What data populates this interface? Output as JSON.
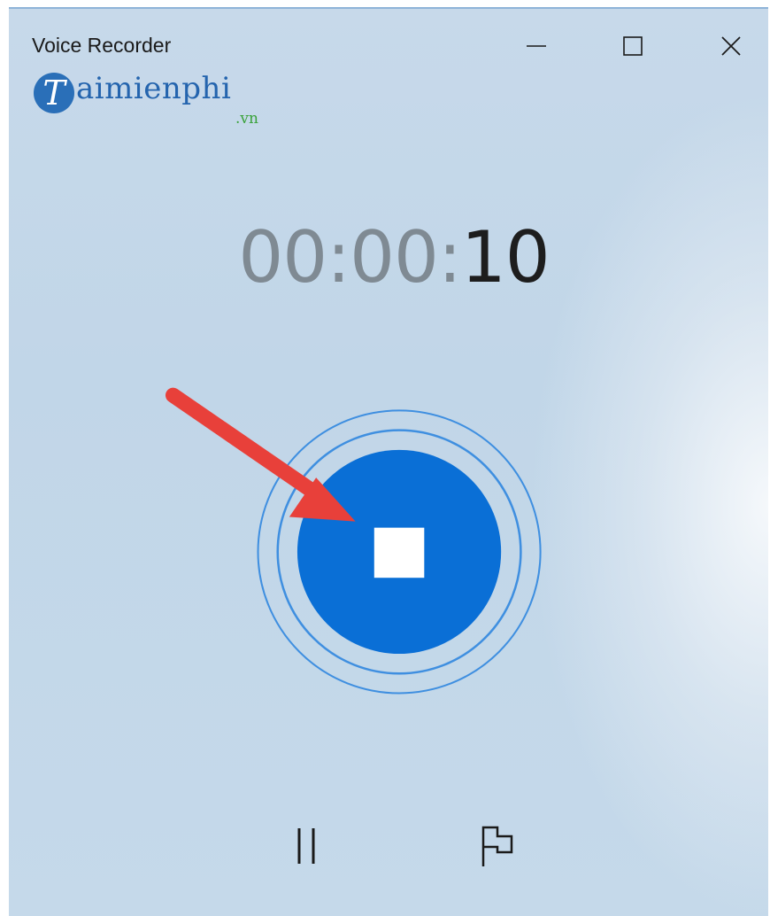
{
  "window": {
    "title": "Voice Recorder",
    "controls": [
      "minimize",
      "maximize",
      "close"
    ]
  },
  "watermark": {
    "brand_letter": "T",
    "brand_word": "aimienphi",
    "tld": ".vn"
  },
  "timer": {
    "hours": "00",
    "sep1": ":",
    "minutes": "00",
    "sep2": ":",
    "seconds": "10"
  },
  "controls": {
    "stop": "stop-icon",
    "pause": "pause-icon",
    "marker": "flag-icon"
  },
  "annotation": {
    "arrow_color": "#e8403a"
  },
  "colors": {
    "accent": "#0a6fd6",
    "ring": "#3f8fe0"
  }
}
